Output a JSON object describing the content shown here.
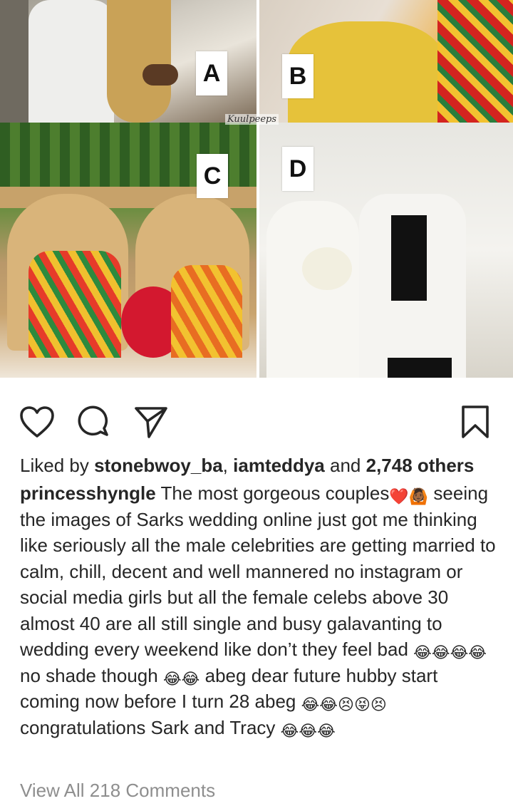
{
  "collage": {
    "labels": [
      "A",
      "B",
      "C",
      "D"
    ],
    "watermark": "Kuulpeeps"
  },
  "actions": {
    "like_icon": "heart-icon",
    "comment_icon": "comment-icon",
    "share_icon": "send-icon",
    "save_icon": "bookmark-icon"
  },
  "likes": {
    "prefix": "Liked by",
    "user1": "stonebwoy_ba",
    "separator": ",",
    "user2": "iamteddya",
    "and": "and",
    "others": "2,748 others"
  },
  "caption": {
    "username": "princesshyngle",
    "part1": "The most gorgeous couples",
    "part2": "seeing the images of Sarks wedding online just got me thinking like seriously all the male celebrities are getting married to calm, chill, decent and well mannered no instagram or social media girls but all the female celebs above 30 almost 40 are all still single and busy galavanting to wedding every weekend like don’t they feel bad",
    "part3": "no shade though",
    "part4": "abeg dear future hubby start coming now before I turn 28 abeg",
    "part5": "congratulations Sark and Tracy",
    "emoji_heart": "❤️",
    "emoji_raised_hands": "🙆🏾",
    "emoji_laugh_x4": "😂😂😂😂",
    "emoji_laugh_x2": "😂😂",
    "emoji_laugh_x2b": "😂😂",
    "emoji_squint_x3": "😣😝😣",
    "emoji_laugh_x3": "😂😂😂"
  },
  "comments": {
    "view_all": "View All 218 Comments"
  }
}
